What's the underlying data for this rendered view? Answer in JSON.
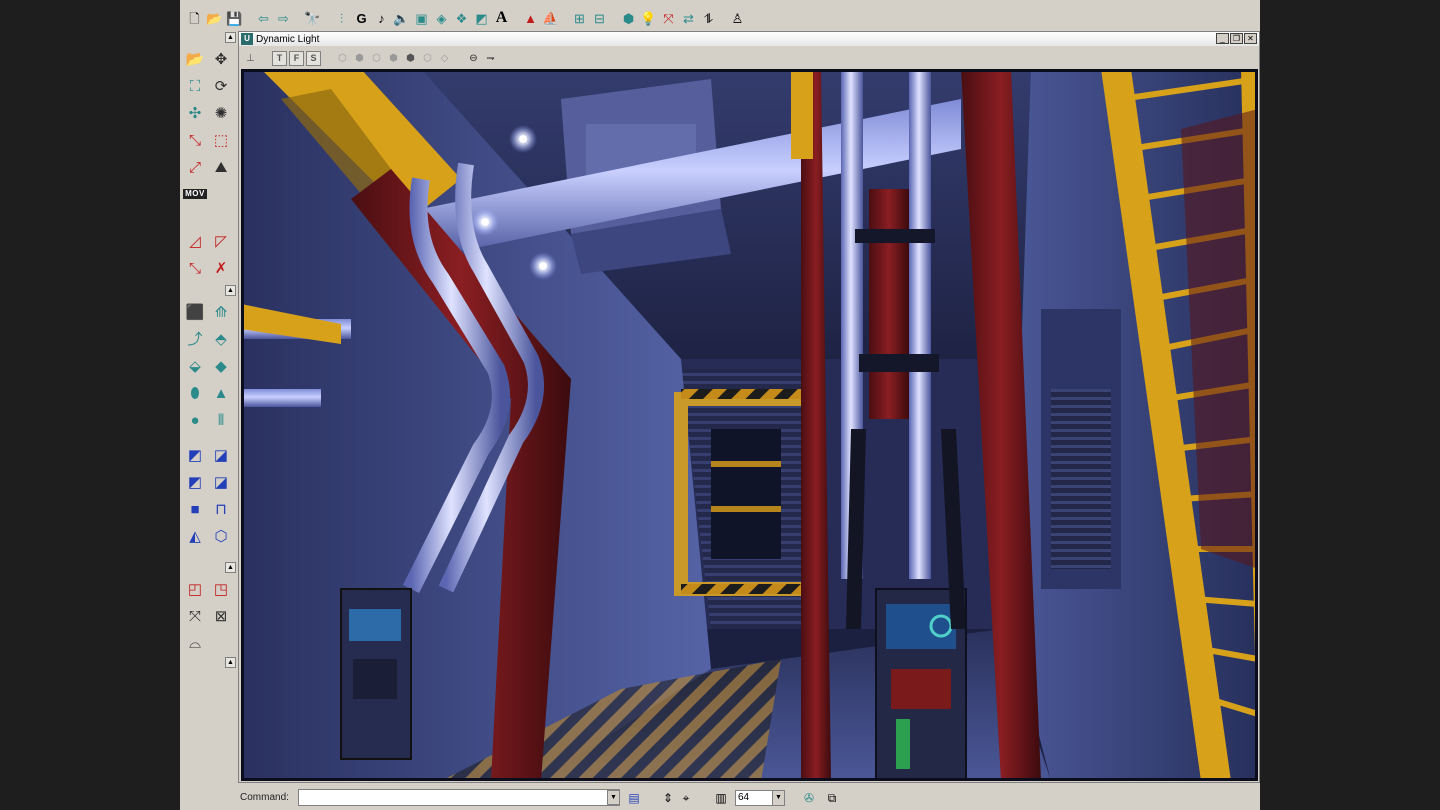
{
  "viewport": {
    "title": "Dynamic Light"
  },
  "statusbar": {
    "command_label": "Command:",
    "command_value": "",
    "grid_size": "64"
  },
  "top_toolbar": {
    "text_tool_glyph": "A"
  },
  "toolbox": {
    "movie_label": "MOV"
  },
  "icons": {
    "top_toolbar": [
      "new-file-icon",
      "open-folder-icon",
      "save-icon",
      "undo-icon",
      "redo-icon",
      "search-icon",
      "actor-browser-icon",
      "group-browser-icon",
      "music-icon",
      "sound-icon",
      "texture-browser-icon",
      "mesh-browser-icon",
      "prefab-icon",
      "static-mesh-icon",
      "font-icon",
      "terrain-icon",
      "animation-icon",
      "kismet-icon",
      "matinee-icon",
      "build-geometry-icon",
      "build-lighting-icon",
      "build-paths-icon",
      "build-all-icon",
      "play-level-icon"
    ],
    "viewport_toolbar": [
      "viewport-menu-icon",
      "top-view-icon",
      "front-view-icon",
      "side-view-icon",
      "wireframe-icon",
      "zone-icon",
      "texture-usage-icon",
      "bsp-cuts-icon",
      "dynamic-light-icon",
      "unlit-icon",
      "realtime-preview-icon",
      "lock-icon"
    ]
  },
  "colors": {
    "chrome": "#d4d0c8",
    "teal_tool": "#2b8a8a",
    "red_tool": "#c21d1d",
    "blue_tool": "#2440b8",
    "scene_blue": "#3a4a8c",
    "scene_red": "#6e1818",
    "scene_yellow": "#d7a21a"
  }
}
